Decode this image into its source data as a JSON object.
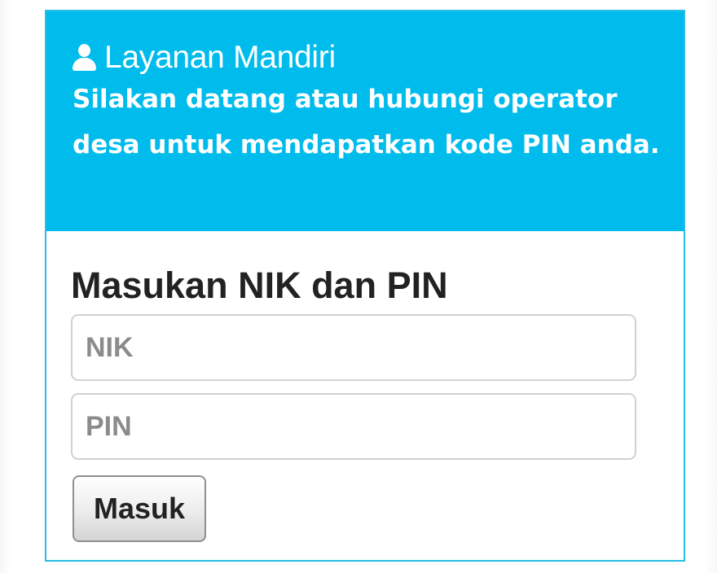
{
  "panel": {
    "heading": {
      "icon": "user-icon",
      "title": "Layanan Mandiri",
      "message": "Silakan datang atau hubungi operator desa untuk mendapatkan kode PIN anda."
    },
    "form": {
      "title": "Masukan NIK dan PIN",
      "nik_placeholder": "NIK",
      "nik_value": "",
      "pin_placeholder": "PIN",
      "pin_value": "",
      "submit_label": "Masuk"
    }
  },
  "colors": {
    "heading_background": "#00bced",
    "panel_border": "#27bde6",
    "heading_text": "#ffffff",
    "body_text": "#222222",
    "input_border": "#d1d1d1",
    "placeholder_text": "#8b8b8b"
  }
}
